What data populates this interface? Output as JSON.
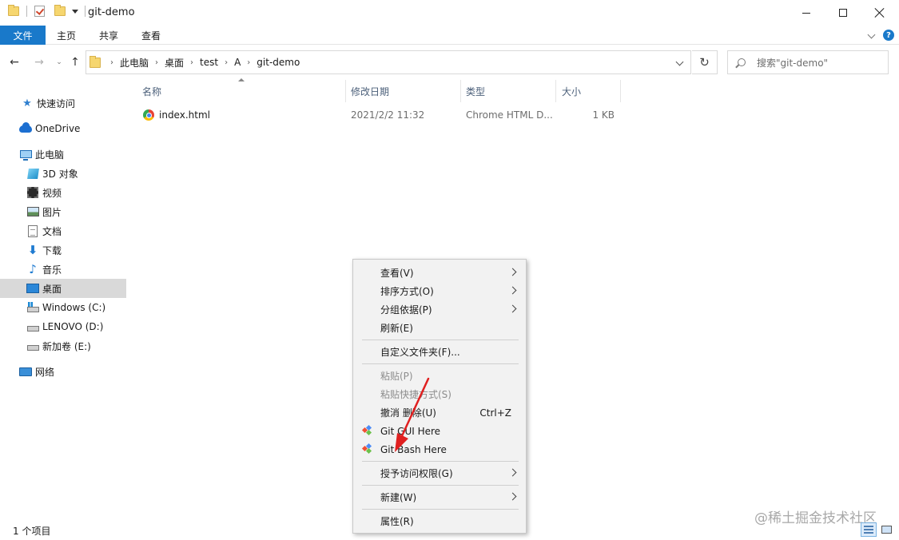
{
  "window": {
    "title": "git-demo"
  },
  "ribbon": {
    "tabs": [
      "文件",
      "主页",
      "共享",
      "查看"
    ],
    "help_label": "?"
  },
  "address": {
    "crumbs": [
      "此电脑",
      "桌面",
      "test",
      "A",
      "git-demo"
    ],
    "search_placeholder": "搜索\"git-demo\""
  },
  "nav": {
    "items": [
      {
        "label": "快速访问",
        "icon": "star-icon"
      },
      {
        "label": "OneDrive",
        "icon": "cloud-icon"
      },
      {
        "label": "此电脑",
        "icon": "computer-icon"
      },
      {
        "label": "3D 对象",
        "icon": "cube-icon"
      },
      {
        "label": "视频",
        "icon": "video-icon"
      },
      {
        "label": "图片",
        "icon": "picture-icon"
      },
      {
        "label": "文档",
        "icon": "document-icon"
      },
      {
        "label": "下载",
        "icon": "download-icon"
      },
      {
        "label": "音乐",
        "icon": "music-icon"
      },
      {
        "label": "桌面",
        "icon": "desktop-icon",
        "selected": true
      },
      {
        "label": "Windows (C:)",
        "icon": "drive-icon"
      },
      {
        "label": "LENOVO (D:)",
        "icon": "drive-icon"
      },
      {
        "label": "新加卷 (E:)",
        "icon": "drive-icon"
      },
      {
        "label": "网络",
        "icon": "network-icon"
      }
    ]
  },
  "files": {
    "columns": [
      "名称",
      "修改日期",
      "类型",
      "大小"
    ],
    "rows": [
      {
        "name": "index.html",
        "date": "2021/2/2 11:32",
        "type": "Chrome HTML D...",
        "size": "1 KB",
        "icon": "chrome-icon"
      }
    ]
  },
  "context_menu": {
    "items": [
      {
        "label": "查看(V)",
        "submenu": true
      },
      {
        "label": "排序方式(O)",
        "submenu": true
      },
      {
        "label": "分组依据(P)",
        "submenu": true
      },
      {
        "label": "刷新(E)"
      },
      {
        "label": "自定义文件夹(F)..."
      },
      {
        "label": "粘贴(P)",
        "disabled": true
      },
      {
        "label": "粘贴快捷方式(S)",
        "disabled": true
      },
      {
        "label": "撤消 删除(U)",
        "shortcut": "Ctrl+Z"
      },
      {
        "label": "Git GUI Here",
        "icon": "git-icon"
      },
      {
        "label": "Git Bash Here",
        "icon": "git-icon"
      },
      {
        "label": "授予访问权限(G)",
        "submenu": true
      },
      {
        "label": "新建(W)",
        "submenu": true
      },
      {
        "label": "属性(R)"
      }
    ]
  },
  "status": {
    "item_count": "1 个项目"
  },
  "watermark": "@稀土掘金技术社区",
  "colors": {
    "accent": "#1979ca",
    "arrow": "#e02020",
    "selection": "#d9d9d9"
  }
}
